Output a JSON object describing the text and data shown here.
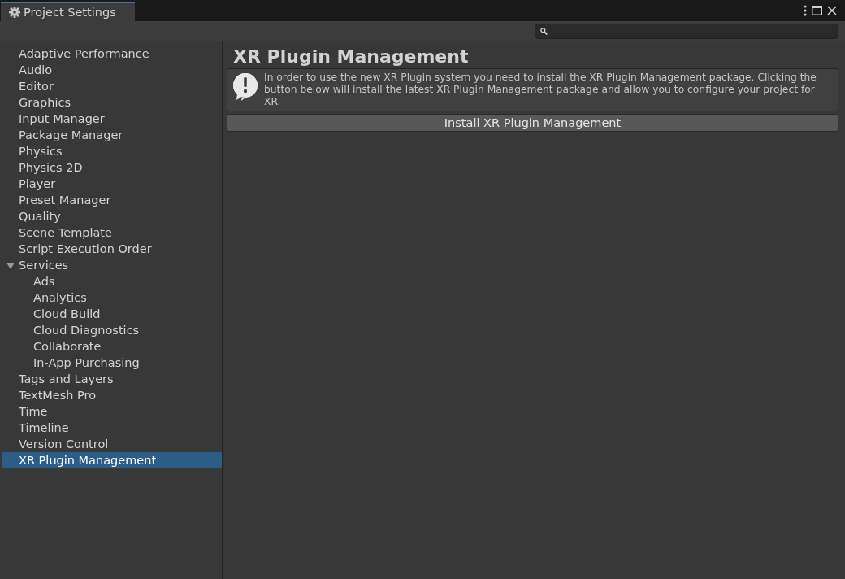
{
  "window": {
    "tab_title": "Project Settings"
  },
  "sidebar": {
    "items": [
      {
        "label": "Adaptive Performance",
        "selected": false
      },
      {
        "label": "Audio",
        "selected": false
      },
      {
        "label": "Editor",
        "selected": false
      },
      {
        "label": "Graphics",
        "selected": false
      },
      {
        "label": "Input Manager",
        "selected": false
      },
      {
        "label": "Package Manager",
        "selected": false
      },
      {
        "label": "Physics",
        "selected": false
      },
      {
        "label": "Physics 2D",
        "selected": false
      },
      {
        "label": "Player",
        "selected": false
      },
      {
        "label": "Preset Manager",
        "selected": false
      },
      {
        "label": "Quality",
        "selected": false
      },
      {
        "label": "Scene Template",
        "selected": false
      },
      {
        "label": "Script Execution Order",
        "selected": false
      },
      {
        "label": "Services",
        "selected": false,
        "expanded": true,
        "children": [
          {
            "label": "Ads",
            "selected": false
          },
          {
            "label": "Analytics",
            "selected": false
          },
          {
            "label": "Cloud Build",
            "selected": false
          },
          {
            "label": "Cloud Diagnostics",
            "selected": false
          },
          {
            "label": "Collaborate",
            "selected": false
          },
          {
            "label": "In-App Purchasing",
            "selected": false
          }
        ]
      },
      {
        "label": "Tags and Layers",
        "selected": false
      },
      {
        "label": "TextMesh Pro",
        "selected": false
      },
      {
        "label": "Time",
        "selected": false
      },
      {
        "label": "Timeline",
        "selected": false
      },
      {
        "label": "Version Control",
        "selected": false
      },
      {
        "label": "XR Plugin Management",
        "selected": true
      }
    ]
  },
  "panel": {
    "title": "XR Plugin Management",
    "help_box": {
      "kind": "warning",
      "text": "In order to use the new XR Plugin system you need to install the XR Plugin Management package. Clicking the button below will install the latest XR Plugin Management package and allow you to configure your project for XR."
    },
    "button": "Install XR Plugin Management"
  }
}
